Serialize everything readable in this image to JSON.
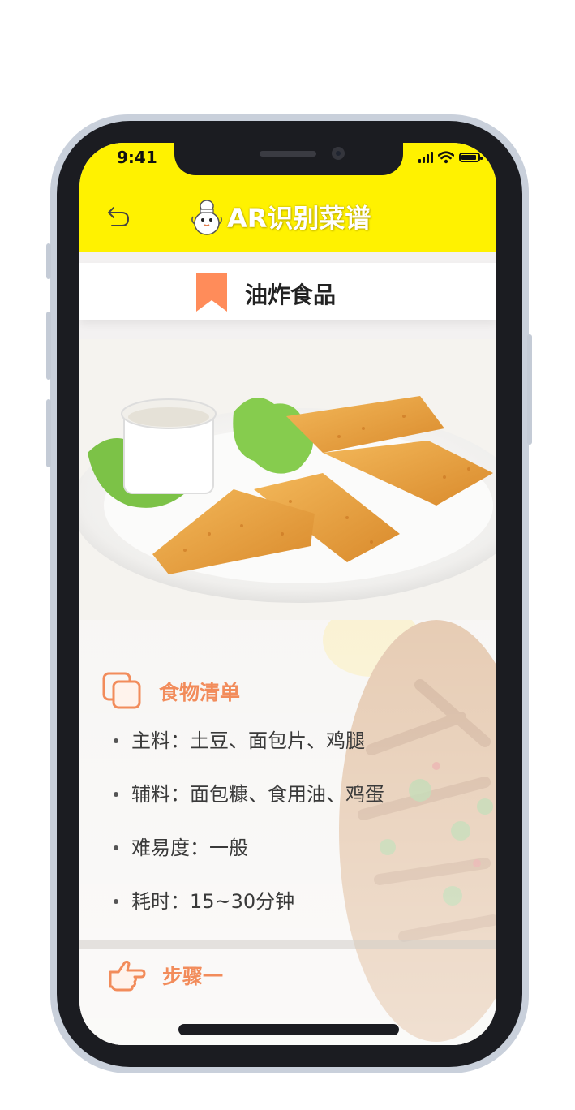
{
  "status_bar": {
    "time": "9:41"
  },
  "header": {
    "title": "AR识别菜谱"
  },
  "category": {
    "title": "油炸食品"
  },
  "ingredients": {
    "heading": "食物清单",
    "items": [
      "主料：土豆、面包片、鸡腿",
      "辅料：面包糠、食用油、鸡蛋",
      "难易度：一般",
      "耗时：15~30分钟"
    ]
  },
  "steps": {
    "heading": "步骤一"
  },
  "colors": {
    "header_bg": "#fff200",
    "accent": "#f28c5b",
    "frame": "#1b1c21"
  },
  "icons": [
    "back-arrow-icon",
    "mascot-icon",
    "bookmark-icon",
    "copy-icon",
    "pointing-hand-icon",
    "signal-icon",
    "wifi-icon",
    "battery-icon"
  ]
}
